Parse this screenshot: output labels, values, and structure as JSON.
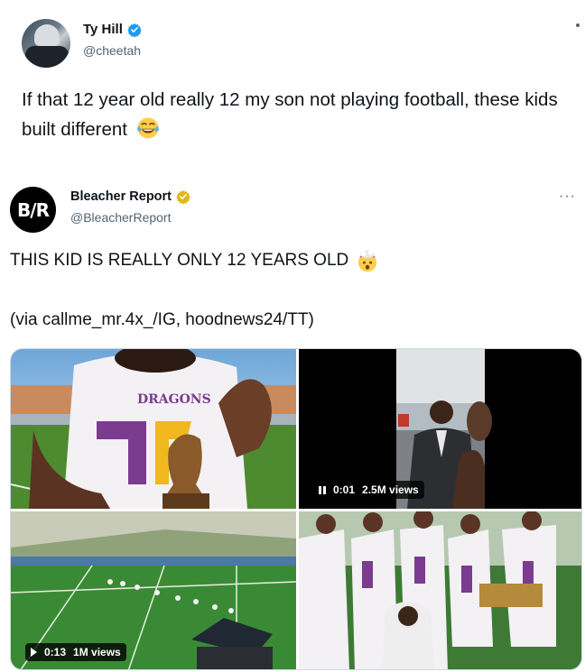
{
  "outer_tweet": {
    "name": "Ty Hill",
    "handle": "@cheetah",
    "text": "If that 12 year old really 12 my son not playing football, these kids built different",
    "emoji_icon": "tears-of-joy-emoji"
  },
  "quoted_tweet": {
    "name": "Bleacher Report",
    "handle": "@BleacherReport",
    "avatar_text": "B/R",
    "text_line1": "THIS KID IS REALLY ONLY 12 YEARS OLD",
    "emoji_icon": "exploding-head-emoji",
    "text_line2": "(via callme_mr.4x_/IG, hoodnews24/TT)",
    "media": {
      "video1": {
        "time": "0:01",
        "views": "2.5M views",
        "state": "paused"
      },
      "video2": {
        "time": "0:13",
        "views": "1M views",
        "state": "play"
      }
    }
  },
  "colors": {
    "text": "#0f1419",
    "secondary": "#536471",
    "verified_blue": "#1d9bf0",
    "verified_gold": "#e2b719"
  }
}
